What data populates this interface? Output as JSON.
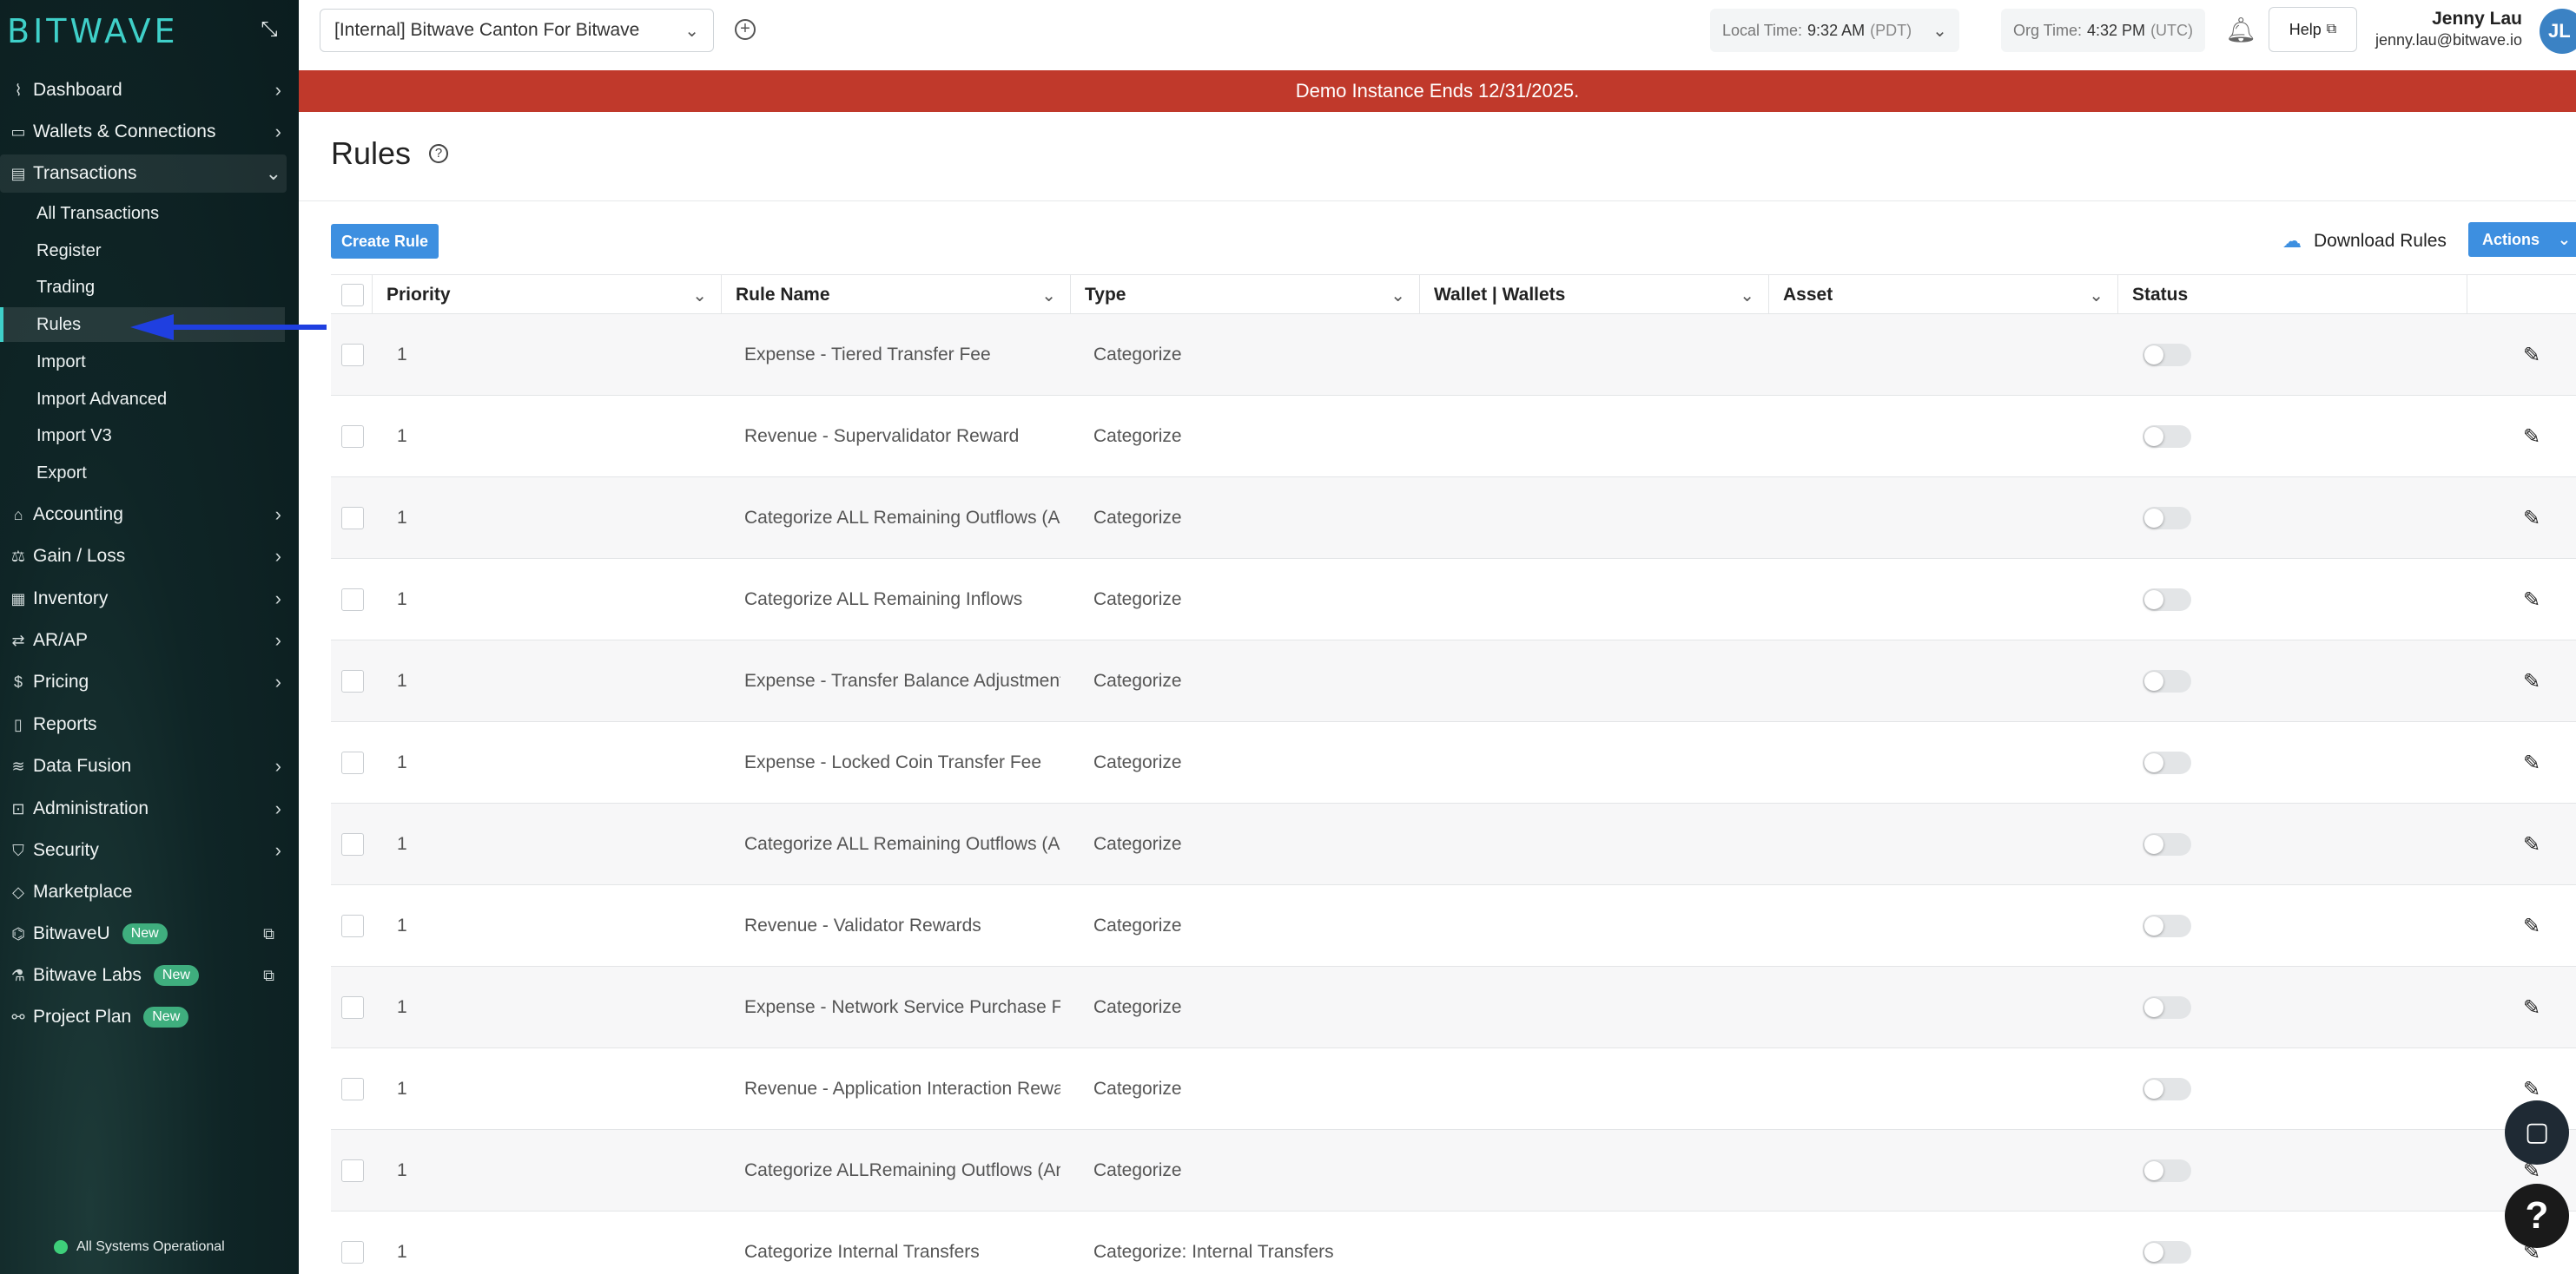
{
  "sidebar": {
    "logo": "BITWAVE",
    "items": [
      {
        "label": "Dashboard",
        "icon": "chart-line-icon"
      },
      {
        "label": "Wallets & Connections",
        "icon": "wallet-icon"
      },
      {
        "label": "Transactions",
        "icon": "table-icon"
      },
      {
        "label": "Accounting",
        "icon": "bank-icon"
      },
      {
        "label": "Gain / Loss",
        "icon": "scale-icon"
      },
      {
        "label": "Inventory",
        "icon": "warehouse-icon"
      },
      {
        "label": "AR/AP",
        "icon": "swap-icon"
      },
      {
        "label": "Pricing",
        "icon": "dollar-icon"
      },
      {
        "label": "Reports",
        "icon": "document-icon"
      },
      {
        "label": "Data Fusion",
        "icon": "database-icon"
      },
      {
        "label": "Administration",
        "icon": "admin-icon"
      },
      {
        "label": "Security",
        "icon": "shield-icon"
      },
      {
        "label": "Marketplace",
        "icon": "tag-icon"
      },
      {
        "label": "BitwaveU",
        "icon": "graduation-cap-icon",
        "badge": "New"
      },
      {
        "label": "Bitwave Labs",
        "icon": "flask-icon",
        "badge": "New"
      },
      {
        "label": "Project Plan",
        "icon": "binoculars-icon",
        "badge": "New"
      }
    ],
    "transactions_sub": [
      "All Transactions",
      "Register",
      "Trading",
      "Rules",
      "Import",
      "Import Advanced",
      "Import V3",
      "Export"
    ],
    "active_sub": "Rules",
    "system_status": "All Systems Operational"
  },
  "topbar": {
    "org_select": "[Internal] Bitwave Canton For Bitwave",
    "local_time_label": "Local Time:",
    "local_time": "9:32 AM",
    "local_tz": "(PDT)",
    "org_time_label": "Org Time:",
    "org_time": "4:32 PM",
    "org_tz": "(UTC)",
    "help_label": "Help",
    "user_name": "Jenny Lau",
    "user_email": "jenny.lau@bitwave.io",
    "avatar_initials": "JL"
  },
  "banner": "Demo Instance Ends 12/31/2025.",
  "page": {
    "title": "Rules",
    "create_button": "Create Rule",
    "download_link": "Download Rules",
    "actions_button": "Actions"
  },
  "table": {
    "columns": [
      "Priority",
      "Rule Name",
      "Type",
      "Wallet | Wallets",
      "Asset",
      "Status"
    ],
    "rows": [
      {
        "priority": "1",
        "name": "Expense - Tiered Transfer Fee",
        "type": "Categorize",
        "enabled": false
      },
      {
        "priority": "1",
        "name": "Revenue - Supervalidator Reward",
        "type": "Categorize",
        "enabled": false
      },
      {
        "priority": "1",
        "name": "Categorize ALL Remaining Outflows (Ar",
        "type": "Categorize",
        "enabled": false
      },
      {
        "priority": "1",
        "name": "Categorize ALL Remaining Inflows",
        "type": "Categorize",
        "enabled": false
      },
      {
        "priority": "1",
        "name": "Expense - Transfer Balance Adjustment",
        "type": "Categorize",
        "enabled": false
      },
      {
        "priority": "1",
        "name": "Expense - Locked Coin Transfer Fee",
        "type": "Categorize",
        "enabled": false
      },
      {
        "priority": "1",
        "name": "Categorize ALL Remaining Outflows (Ar",
        "type": "Categorize",
        "enabled": false
      },
      {
        "priority": "1",
        "name": "Revenue - Validator Rewards",
        "type": "Categorize",
        "enabled": false
      },
      {
        "priority": "1",
        "name": "Expense - Network Service Purchase Fe",
        "type": "Categorize",
        "enabled": false
      },
      {
        "priority": "1",
        "name": "Revenue - Application Interaction Rewa",
        "type": "Categorize",
        "enabled": false
      },
      {
        "priority": "1",
        "name": "Categorize ALLRemaining Outflows (An",
        "type": "Categorize",
        "enabled": false
      },
      {
        "priority": "1",
        "name": "Categorize Internal Transfers",
        "type": "Categorize: Internal Transfers",
        "enabled": false
      }
    ]
  },
  "colors": {
    "sidebar_bg": "#0f2526",
    "accent": "#3d8fe0",
    "logo": "#3fd0c9",
    "banner": "#c0392b",
    "badge": "#3fae7e",
    "annotation_arrow": "#1f3fe0"
  }
}
